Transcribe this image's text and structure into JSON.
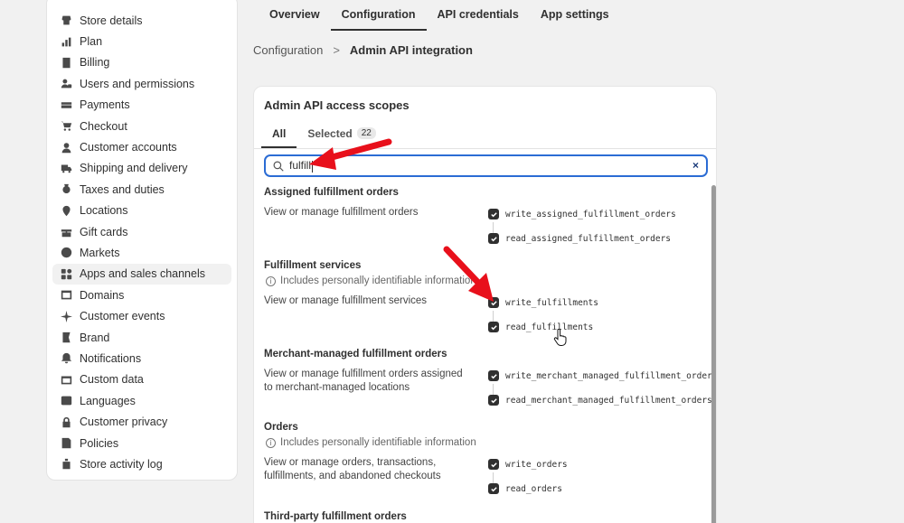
{
  "sidebar": {
    "items": [
      {
        "label": "Store details",
        "icon": "store-icon"
      },
      {
        "label": "Plan",
        "icon": "plan-icon"
      },
      {
        "label": "Billing",
        "icon": "billing-icon"
      },
      {
        "label": "Users and permissions",
        "icon": "users-icon"
      },
      {
        "label": "Payments",
        "icon": "payments-icon"
      },
      {
        "label": "Checkout",
        "icon": "cart-icon"
      },
      {
        "label": "Customer accounts",
        "icon": "person-icon"
      },
      {
        "label": "Shipping and delivery",
        "icon": "truck-icon"
      },
      {
        "label": "Taxes and duties",
        "icon": "tax-icon"
      },
      {
        "label": "Locations",
        "icon": "location-icon"
      },
      {
        "label": "Gift cards",
        "icon": "gift-icon"
      },
      {
        "label": "Markets",
        "icon": "globe-icon"
      },
      {
        "label": "Apps and sales channels",
        "icon": "apps-icon"
      },
      {
        "label": "Domains",
        "icon": "domain-icon"
      },
      {
        "label": "Customer events",
        "icon": "sparkle-icon"
      },
      {
        "label": "Brand",
        "icon": "brand-icon"
      },
      {
        "label": "Notifications",
        "icon": "bell-icon"
      },
      {
        "label": "Custom data",
        "icon": "data-icon"
      },
      {
        "label": "Languages",
        "icon": "language-icon"
      },
      {
        "label": "Customer privacy",
        "icon": "lock-icon"
      },
      {
        "label": "Policies",
        "icon": "policy-icon"
      },
      {
        "label": "Store activity log",
        "icon": "activity-icon"
      }
    ],
    "active_index": 12
  },
  "top_tabs": [
    "Overview",
    "Configuration",
    "API credentials",
    "App settings"
  ],
  "breadcrumb": {
    "parent": "Configuration",
    "separator": ">",
    "current": "Admin API integration"
  },
  "card": {
    "title": "Admin API access scopes",
    "tabs": {
      "all": "All",
      "selected": "Selected",
      "selected_count": "22"
    },
    "search": {
      "value": "fulfill",
      "clear": "×"
    },
    "pii_note": "Includes personally identifiable information",
    "sections": [
      {
        "title": "Assigned fulfillment orders",
        "desc": "View or manage fulfillment orders",
        "scopes": [
          "write_assigned_fulfillment_orders",
          "read_assigned_fulfillment_orders"
        ]
      },
      {
        "title": "Fulfillment services",
        "desc": "View or manage fulfillment services",
        "scopes": [
          "write_fulfillments",
          "read_fulfillments"
        ]
      },
      {
        "title": "Merchant-managed fulfillment orders",
        "desc": "View or manage fulfillment orders assigned to merchant-managed locations",
        "scopes": [
          "write_merchant_managed_fulfillment_orders",
          "read_merchant_managed_fulfillment_orders"
        ]
      },
      {
        "title": "Orders",
        "desc": "View or manage orders, transactions, fulfillments, and abandoned checkouts",
        "scopes": [
          "write_orders",
          "read_orders"
        ]
      },
      {
        "title": "Third-party fulfillment orders"
      }
    ]
  },
  "colors": {
    "accent": "#2b6cd4",
    "annotation": "#e8101b",
    "checkbox": "#303030"
  }
}
